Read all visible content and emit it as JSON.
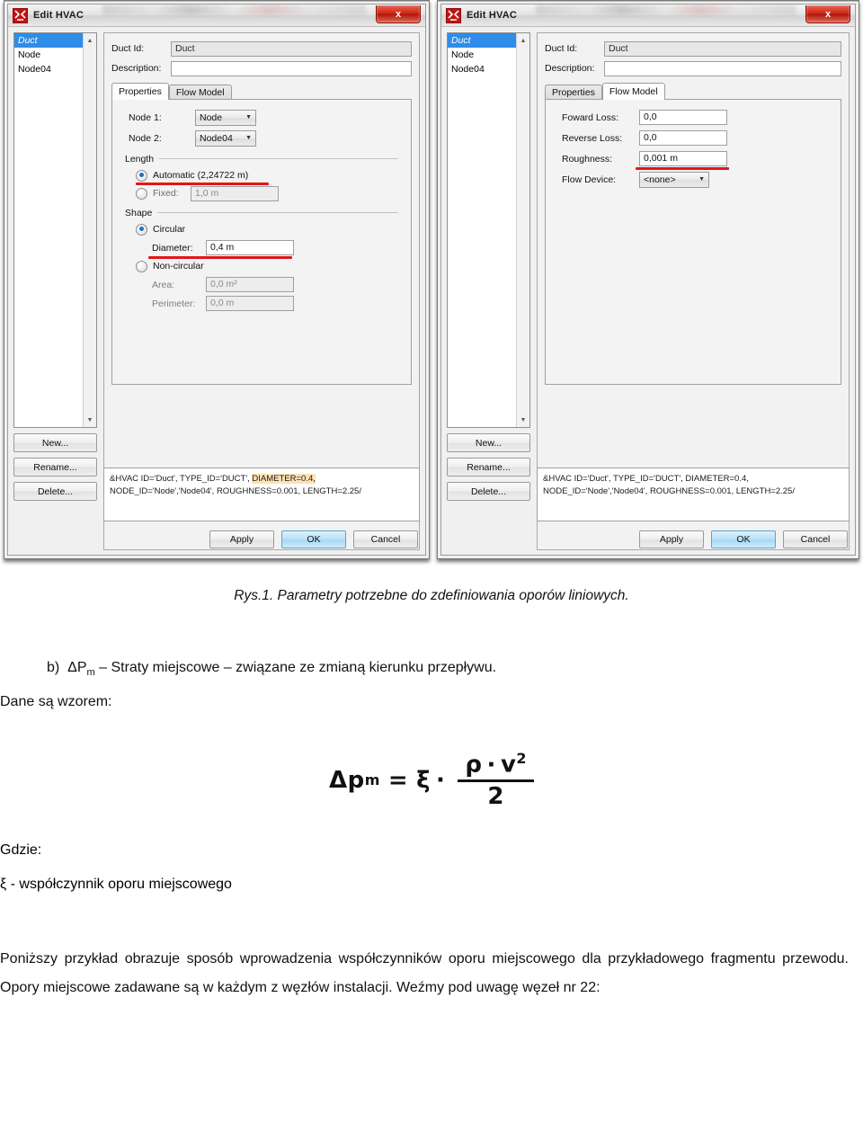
{
  "dialogs": [
    {
      "title": "Edit HVAC",
      "close_label": "x",
      "list": {
        "items": [
          "Duct",
          "Node",
          "Node04"
        ],
        "selected_index": 0
      },
      "side_buttons": [
        "New...",
        "Rename...",
        "Delete..."
      ],
      "fields": {
        "duct_id_label": "Duct Id:",
        "duct_id_value": "Duct",
        "description_label": "Description:",
        "description_value": ""
      },
      "tabs": [
        {
          "label": "Properties",
          "active": true
        },
        {
          "label": "Flow Model",
          "active": false
        }
      ],
      "properties": {
        "node1_label": "Node 1:",
        "node1_value": "Node",
        "node2_label": "Node 2:",
        "node2_value": "Node04",
        "length_group": "Length",
        "length_automatic_label": "Automatic (2,24722 m)",
        "length_automatic_selected": true,
        "length_fixed_label": "Fixed:",
        "length_fixed_value": "1,0 m",
        "shape_group": "Shape",
        "shape_circular_label": "Circular",
        "shape_circular_selected": true,
        "diameter_label": "Diameter:",
        "diameter_value": "0,4 m",
        "shape_noncircular_label": "Non-circular",
        "area_label": "Area:",
        "area_value": "0,0 m²",
        "perimeter_label": "Perimeter:",
        "perimeter_value": "0,0 m"
      },
      "namelist": {
        "line1_pre": "&HVAC ID='Duct', TYPE_ID='DUCT', ",
        "line1_highlight": "DIAMETER=0.4,",
        "line2": "NODE_ID='Node','Node04', ROUGHNESS=0.001, LENGTH=2.25/"
      },
      "buttons": [
        {
          "label": "Apply",
          "default": false
        },
        {
          "label": "OK",
          "default": true
        },
        {
          "label": "Cancel",
          "default": false
        }
      ]
    },
    {
      "title": "Edit HVAC",
      "close_label": "x",
      "list": {
        "items": [
          "Duct",
          "Node",
          "Node04"
        ],
        "selected_index": 0
      },
      "side_buttons": [
        "New...",
        "Rename...",
        "Delete..."
      ],
      "fields": {
        "duct_id_label": "Duct Id:",
        "duct_id_value": "Duct",
        "description_label": "Description:",
        "description_value": ""
      },
      "tabs": [
        {
          "label": "Properties",
          "active": false
        },
        {
          "label": "Flow Model",
          "active": true
        }
      ],
      "flow_model": {
        "foward_loss_label": "Foward Loss:",
        "foward_loss_value": "0,0",
        "reverse_loss_label": "Reverse Loss:",
        "reverse_loss_value": "0,0",
        "roughness_label": "Roughness:",
        "roughness_value": "0,001 m",
        "flow_device_label": "Flow Device:",
        "flow_device_value": "<none>"
      },
      "namelist": {
        "line1_pre": "&HVAC ID='Duct', TYPE_ID='DUCT', DIAMETER=0.4,",
        "line1_highlight": "",
        "line2": "NODE_ID='Node','Node04', ROUGHNESS=0.001, LENGTH=2.25/"
      },
      "buttons": [
        {
          "label": "Apply",
          "default": false
        },
        {
          "label": "OK",
          "default": true
        },
        {
          "label": "Cancel",
          "default": false
        }
      ]
    }
  ],
  "document": {
    "figure_caption": "Rys.1. Parametry potrzebne do zdefiniowania oporów liniowych.",
    "item_b_marker": "b)",
    "item_b_prefix": "ΔP",
    "item_b_sub": "m",
    "item_b_text": " – Straty miejscowe – związane ze zmianą kierunku przepływu.",
    "formula_intro": "Dane są wzorem:",
    "formula": {
      "lhs_base": "Δp",
      "lhs_sub": "m",
      "equals": "=",
      "xi": "ξ",
      "dot": "·",
      "numerator_rho": "ρ",
      "numerator_dot": "·",
      "numerator_v": "v",
      "numerator_exp": "2",
      "denominator": "2"
    },
    "where_label": "Gdzie:",
    "xi_definition": "ξ - współczynnik oporu miejscowego",
    "body_paragraph": "Poniższy przykład obrazuje sposób wprowadzenia współczynników oporu miejscowego dla przykładowego fragmentu przewodu. Opory miejscowe zadawane są w każdym z węzłów instalacji. Weźmy pod uwagę węzeł nr 22:"
  },
  "colors": {
    "selection_blue": "#2f8ce8",
    "underline_red": "#e01717",
    "highlight_amber": "#fbe2b4",
    "close_red": "#cf2b1b",
    "default_button_blue": "#b9e1f7"
  }
}
